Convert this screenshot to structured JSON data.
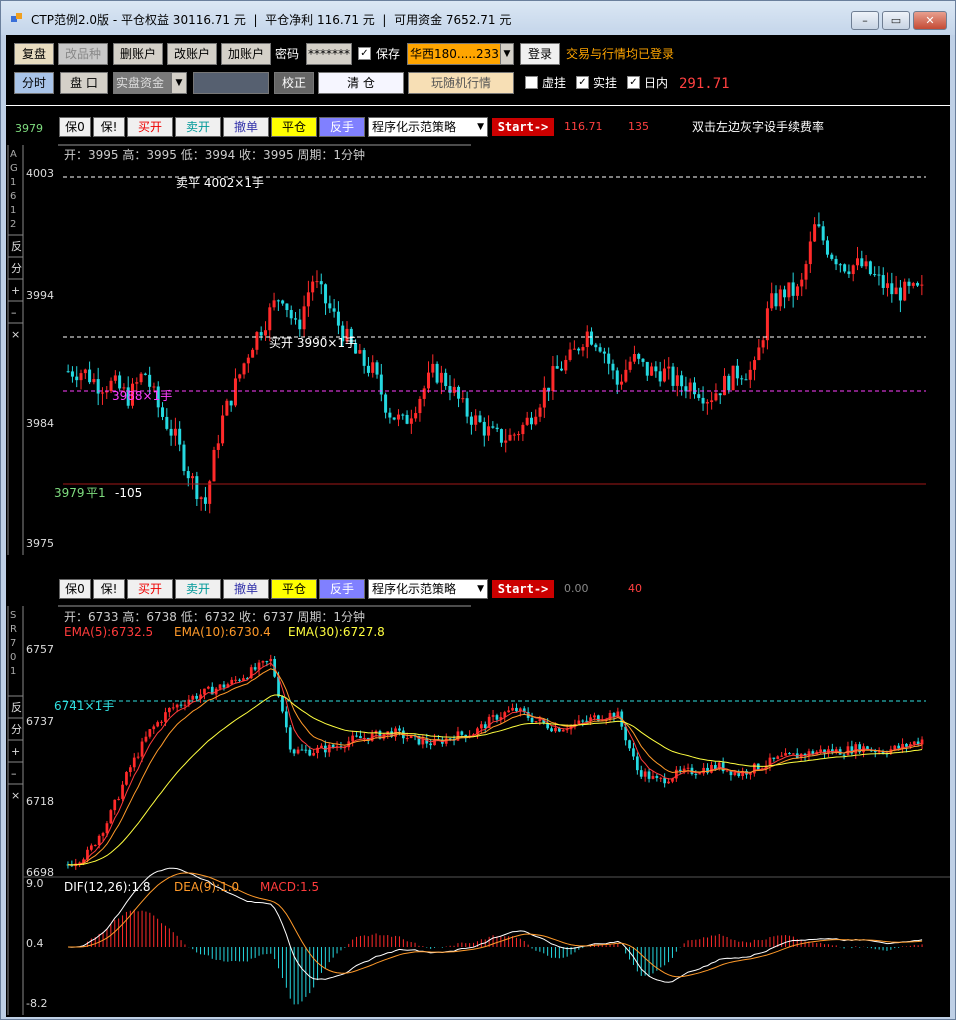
{
  "window": {
    "title": "CTP范例2.0版 - 平仓权益 30116.71 元  |  平仓净利 116.71 元  |  可用资金 7652.71 元",
    "min_label": "–",
    "max_label": "▭",
    "close_label": "✕"
  },
  "toolbar1": {
    "fupan": "复盘",
    "gaipinzhong": "改品种",
    "shanzhanghu": "删账户",
    "gaizhanghu": "改账户",
    "jiazhanghu": "加账户",
    "mima_label": "密码",
    "password_value": "*******",
    "baocun_label": "保存",
    "baocun_checked": "✓",
    "broker_value": "华西180.....233",
    "login": "登录",
    "status": "交易与行情均已登录"
  },
  "toolbar2": {
    "fenshi": "分时",
    "pankou": "盘 口",
    "account_type": "实盘资金",
    "jiaozheng": "校正",
    "qingcang": "清 仓",
    "wan": "玩随机行情",
    "xugua": "虚挂",
    "shigua": "实挂",
    "rinei": "日内",
    "shigua_checked": "✓",
    "rinei_checked": "✓",
    "pnl": "291.71"
  },
  "chart1": {
    "price_now": "3979",
    "buttons": {
      "bao0": "保0",
      "bao1": "保!",
      "buy": "买开",
      "sell": "卖开",
      "cancel": "撤单",
      "close": "平仓",
      "reverse": "反手"
    },
    "strategy": "程序化示范策略",
    "start": "Start->",
    "profit": "116.71",
    "count": "135",
    "hint": "双击左边灰字设手续费率",
    "side_label": "AG1612",
    "side_buttons": [
      "反",
      "分",
      "+",
      "–",
      "×"
    ],
    "info": "开：3995   高：3995   低：3994   收：3995   周期：1分钟",
    "y_labels": [
      "4003",
      "3994",
      "3984",
      "3975"
    ],
    "order_sell": "卖平 4002×1手",
    "order_buy": "买开 3990×1手",
    "order_pos": "3988×1手",
    "trade_price": "3979",
    "trade_action": "平1",
    "trade_pnl": "-105"
  },
  "chart2": {
    "buttons": {
      "bao0": "保0",
      "bao1": "保!",
      "buy": "买开",
      "sell": "卖开",
      "cancel": "撤单",
      "close": "平仓",
      "reverse": "反手"
    },
    "strategy": "程序化示范策略",
    "start": "Start->",
    "profit": "0.00",
    "count": "40",
    "side_label": "SR701",
    "side_buttons": [
      "反",
      "分",
      "+",
      "–",
      "×"
    ],
    "info": "开：6733   高：6738   低：6732   收：6737   周期：1分钟",
    "ema5": "EMA(5):6732.5",
    "ema10": "EMA(10):6730.4",
    "ema30": "EMA(30):6727.8",
    "y_labels": [
      "6757",
      "6737",
      "6718",
      "6698"
    ],
    "order_pos": "6741×1手",
    "macd_labels": [
      "9.0",
      "0.4",
      "-8.2"
    ],
    "dif": "DIF(12,26):1.8",
    "dea": "DEA(9):1.0",
    "macd": "MACD:1.5"
  },
  "colors": {
    "up": "#ff2a2a",
    "down": "#25d8e0",
    "ema5": "#ff3c3c",
    "ema10": "#ff9a2a",
    "ema30": "#ffff40",
    "dash_white": "#ffffff",
    "dash_magenta": "#ff40ff",
    "dash_cyan": "#30e0e0",
    "accent": "#ffa500"
  }
}
